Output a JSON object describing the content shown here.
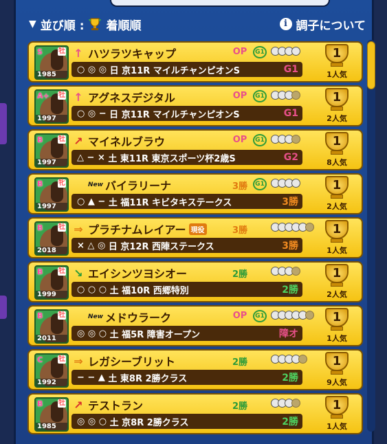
{
  "header": {
    "sort_label": "並び順 :",
    "sort_value": "着順順",
    "info_label": "調子について"
  },
  "horses": [
    {
      "grade": "S",
      "sex": "牡",
      "year": "1985",
      "arrow": "↑",
      "arrow_color": "#e8508a",
      "new": "",
      "name": "ハツラツキャップ",
      "genek": "",
      "cls": "OP",
      "cls_color": "#e8508a",
      "laurel": "G1",
      "pips_on": 4,
      "pips_off": 0,
      "marks": "○ ◎ ◎",
      "day": "日",
      "venue": "京11R",
      "race": "マイルチャンピオンS",
      "rgrade": "G1",
      "rgrade_color": "#e8508a",
      "rank": "1",
      "pop": "1人気"
    },
    {
      "grade": "A+",
      "sex": "牡",
      "year": "1997",
      "arrow": "↑",
      "arrow_color": "#e8508a",
      "new": "",
      "name": "アグネスデジタル",
      "genek": "",
      "cls": "OP",
      "cls_color": "#e8508a",
      "laurel": "G1",
      "pips_on": 3,
      "pips_off": 1,
      "marks": "○ ◎ −",
      "day": "日",
      "venue": "京11R",
      "race": "マイルチャンピオンS",
      "rgrade": "G1",
      "rgrade_color": "#e8508a",
      "rank": "1",
      "pop": "2人気"
    },
    {
      "grade": "B",
      "sex": "牡",
      "year": "1997",
      "arrow": "↗",
      "arrow_color": "#d9302a",
      "new": "",
      "name": "マイネルブラウ",
      "genek": "",
      "cls": "OP",
      "cls_color": "#e8508a",
      "laurel": "G1",
      "pips_on": 3,
      "pips_off": 1,
      "marks": "△ − ×",
      "day": "土",
      "venue": "東11R",
      "race": "東京スポーツ杯2歳S",
      "rgrade": "G2",
      "rgrade_color": "#e8508a",
      "rank": "1",
      "pop": "8人気"
    },
    {
      "grade": "B",
      "sex": "牝",
      "year": "1997",
      "arrow": "",
      "arrow_color": "#3a1d00",
      "new": "New",
      "name": "バイラリーナ",
      "genek": "",
      "cls": "3勝",
      "cls_color": "#e07a10",
      "laurel": "G1",
      "pips_on": 4,
      "pips_off": 0,
      "marks": "○ ▲ −",
      "day": "土",
      "venue": "福11R",
      "race": "キビタキステークス",
      "rgrade": "3勝",
      "rgrade_color": "#f08a20",
      "rank": "1",
      "pop": "2人気"
    },
    {
      "grade": "B",
      "sex": "牡",
      "year": "2018",
      "arrow": "⇒",
      "arrow_color": "#e07a10",
      "new": "",
      "name": "プラチナムレイアー",
      "genek": "現役",
      "cls": "3勝",
      "cls_color": "#e07a10",
      "laurel": "",
      "pips_on": 5,
      "pips_off": 1,
      "marks": "× △ ◎",
      "day": "日",
      "venue": "京12R",
      "race": "西陣ステークス",
      "rgrade": "3勝",
      "rgrade_color": "#f08a20",
      "rank": "1",
      "pop": "1人気"
    },
    {
      "grade": "B",
      "sex": "牡",
      "year": "1999",
      "arrow": "↘",
      "arrow_color": "#2c9b39",
      "new": "",
      "name": "エイシンツヨシオー",
      "genek": "",
      "cls": "2勝",
      "cls_color": "#2c9b39",
      "laurel": "",
      "pips_on": 3,
      "pips_off": 1,
      "marks": "○ ○ ○",
      "day": "土",
      "venue": "福10R",
      "race": "西郷特別",
      "rgrade": "2勝",
      "rgrade_color": "#4ed060",
      "rank": "1",
      "pop": "2人気"
    },
    {
      "grade": "B",
      "sex": "牡",
      "year": "2011",
      "arrow": "",
      "arrow_color": "#3a1d00",
      "new": "New",
      "name": "メドウラーク",
      "genek": "",
      "cls": "OP",
      "cls_color": "#e8508a",
      "laurel": "G1",
      "pips_on": 5,
      "pips_off": 1,
      "marks": "◎ ◎ ○",
      "day": "土",
      "venue": "福5R",
      "race": "障害オープン",
      "rgrade": "障オ",
      "rgrade_color": "#e8508a",
      "rank": "1",
      "pop": "1人気"
    },
    {
      "grade": "C",
      "sex": "牡",
      "year": "1992",
      "arrow": "⇒",
      "arrow_color": "#e07a10",
      "new": "",
      "name": "レガシーブリット",
      "genek": "",
      "cls": "2勝",
      "cls_color": "#2c9b39",
      "laurel": "",
      "pips_on": 4,
      "pips_off": 1,
      "marks": "− − ▲",
      "day": "土",
      "venue": "東8R",
      "race": "2勝クラス",
      "rgrade": "2勝",
      "rgrade_color": "#4ed060",
      "rank": "1",
      "pop": "9人気"
    },
    {
      "grade": "B",
      "sex": "牡",
      "year": "1985",
      "arrow": "↗",
      "arrow_color": "#d9302a",
      "new": "",
      "name": "テストラン",
      "genek": "",
      "cls": "2勝",
      "cls_color": "#2c9b39",
      "laurel": "",
      "pips_on": 3,
      "pips_off": 1,
      "marks": "◎ ◎ ○",
      "day": "土",
      "venue": "京8R",
      "race": "2勝クラス",
      "rgrade": "2勝",
      "rgrade_color": "#4ed060",
      "rank": "1",
      "pop": "1人気"
    }
  ]
}
